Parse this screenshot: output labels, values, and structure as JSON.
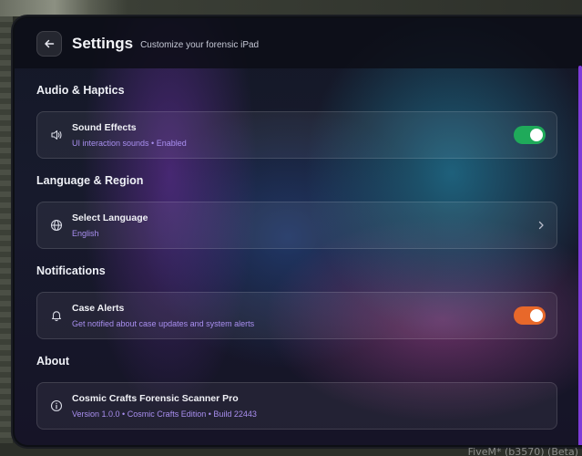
{
  "header": {
    "title": "Settings",
    "subtitle": "Customize your forensic iPad",
    "back_icon": "arrow-left-icon"
  },
  "sections": [
    {
      "title": "Audio & Haptics",
      "item": {
        "icon": "speaker-icon",
        "label": "Sound Effects",
        "description": "UI interaction sounds • Enabled",
        "control": "toggle",
        "enabled": true,
        "toggle_color": "#1faa5a"
      }
    },
    {
      "title": "Language & Region",
      "item": {
        "icon": "globe-icon",
        "label": "Select Language",
        "description": "English",
        "control": "chevron"
      }
    },
    {
      "title": "Notifications",
      "item": {
        "icon": "bell-icon",
        "label": "Case Alerts",
        "description": "Get notified about case updates and system alerts",
        "control": "toggle",
        "enabled": true,
        "toggle_color": "#e8682a"
      }
    },
    {
      "title": "About",
      "item": {
        "icon": "info-icon",
        "label": "Cosmic Crafts Forensic Scanner Pro",
        "description": "Version 1.0.0 • Cosmic Crafts Edition • Build 22443",
        "control": "none"
      }
    }
  ],
  "watermark": "FiveM* (b3570) (Beta)",
  "colors": {
    "accent": "#a98ff0",
    "scrollbar": "#7d3bd8"
  }
}
